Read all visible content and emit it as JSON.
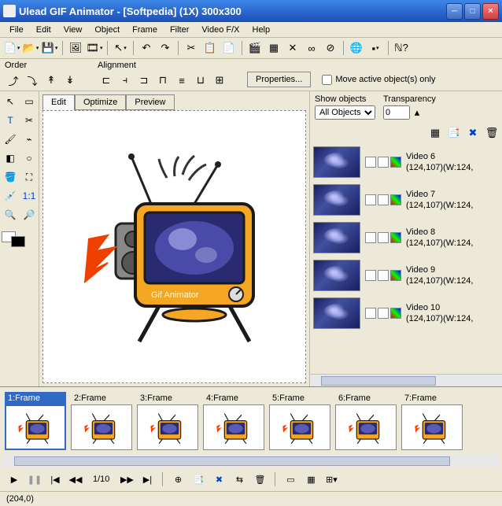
{
  "title": "Ulead GIF Animator - [Softpedia] (1X) 300x300",
  "menu": [
    "File",
    "Edit",
    "View",
    "Object",
    "Frame",
    "Filter",
    "Video F/X",
    "Help"
  ],
  "order_label": "Order",
  "align_label": "Alignment",
  "properties_btn": "Properties...",
  "move_active": "Move active object(s) only",
  "tabs": {
    "edit": "Edit",
    "optimize": "Optimize",
    "preview": "Preview"
  },
  "canvas_text": "Gif Animator",
  "right_panel": {
    "show_objects_label": "Show objects",
    "show_objects_value": "All Objects",
    "transparency_label": "Transparency",
    "transparency_value": "0",
    "items": [
      {
        "name": "Video 6",
        "meta": "(124,107)(W:124,"
      },
      {
        "name": "Video 7",
        "meta": "(124,107)(W:124,"
      },
      {
        "name": "Video 8",
        "meta": "(124,107)(W:124,"
      },
      {
        "name": "Video 9",
        "meta": "(124,107)(W:124,"
      },
      {
        "name": "Video 10",
        "meta": "(124,107)(W:124,"
      }
    ]
  },
  "timeline": {
    "frames": [
      "1:Frame",
      "2:Frame",
      "3:Frame",
      "4:Frame",
      "5:Frame",
      "6:Frame",
      "7:Frame"
    ],
    "position": "1/10"
  },
  "status": "(204,0)"
}
